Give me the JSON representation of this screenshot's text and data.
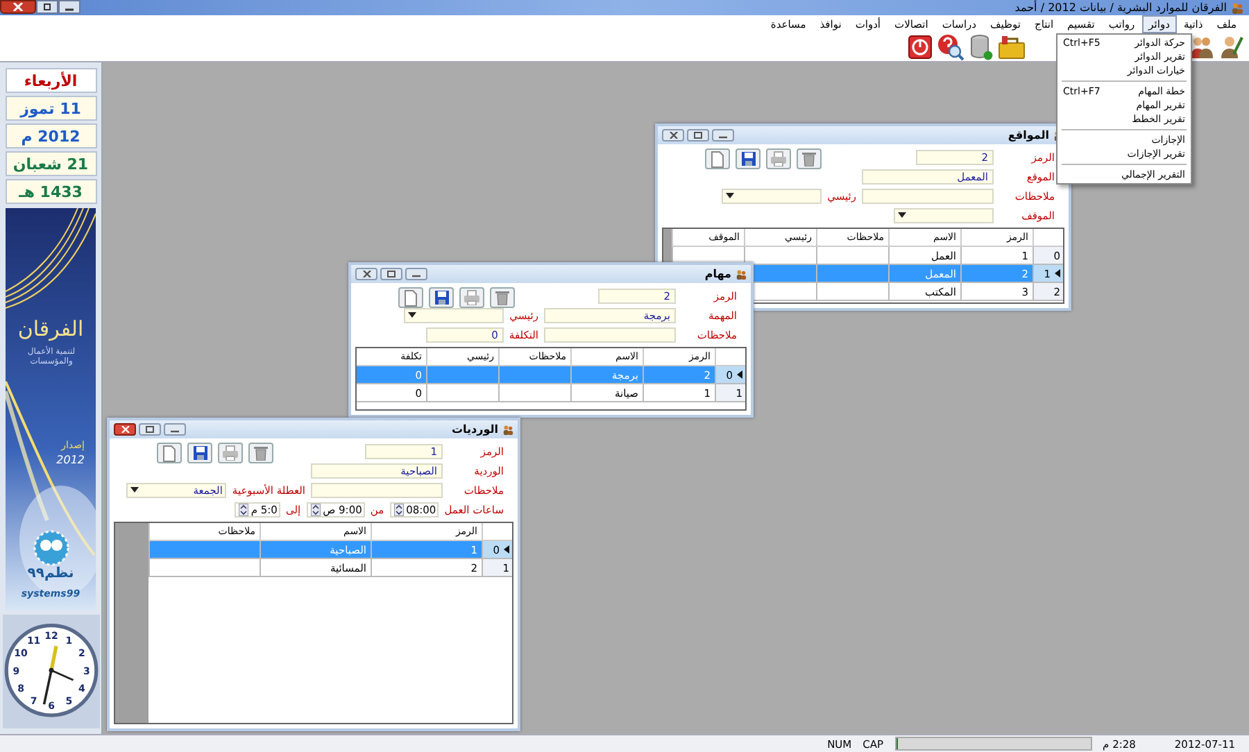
{
  "title_bar": {
    "title": "الفرقان للموارد البشرية / بيانات 2012 / أحمد"
  },
  "menu": [
    {
      "label": "ملف",
      "selected": false
    },
    {
      "label": "ذاتية",
      "selected": false
    },
    {
      "label": "دوائر",
      "selected": true
    },
    {
      "label": "رواتب",
      "selected": false
    },
    {
      "label": "تقسيم",
      "selected": false
    },
    {
      "label": "انتاج",
      "selected": false
    },
    {
      "label": "توظيف",
      "selected": false
    },
    {
      "label": "دراسات",
      "selected": false
    },
    {
      "label": "اتصالات",
      "selected": false
    },
    {
      "label": "أدوات",
      "selected": false
    },
    {
      "label": "نوافذ",
      "selected": false
    },
    {
      "label": "مساعدة",
      "selected": false
    }
  ],
  "dropdown": [
    {
      "kind": "item",
      "label": "حركة الدوائر",
      "shortcut": "Ctrl+F5"
    },
    {
      "kind": "item",
      "label": "تقرير الدوائر"
    },
    {
      "kind": "item",
      "label": "خيارات الدوائر"
    },
    {
      "kind": "separator"
    },
    {
      "kind": "item",
      "label": "خطة المهام",
      "shortcut": "Ctrl+F7"
    },
    {
      "kind": "item",
      "label": "تقرير المهام"
    },
    {
      "kind": "item",
      "label": "تقرير الخطط"
    },
    {
      "kind": "separator"
    },
    {
      "kind": "item",
      "label": "الإجازات"
    },
    {
      "kind": "item",
      "label": "تقرير الإجازات"
    },
    {
      "kind": "separator"
    },
    {
      "kind": "item",
      "label": "التقرير الإجمالي"
    }
  ],
  "calendar": [
    {
      "kind": "weekday",
      "text": "الأربعاء"
    },
    {
      "kind": "gregorian",
      "text": "11 تموز"
    },
    {
      "kind": "gregorian",
      "text": "2012 م"
    },
    {
      "kind": "hijri",
      "text": "21 شعبان"
    },
    {
      "kind": "hijri",
      "text": "1433 هـ"
    }
  ],
  "banner": {
    "title": "الفرقان",
    "subtitle": "لتنمية الأعمال والمؤسسات",
    "edition": "إصدار",
    "year": "2012",
    "brand": "نظم٩٩",
    "brand_latin": "systems99"
  },
  "clock": {
    "numerals": [
      "12",
      "1",
      "11",
      "2",
      "10",
      "3",
      "9",
      "4",
      "8",
      "5",
      "7",
      "6"
    ]
  },
  "windows": [
    {
      "title": "المواقع",
      "active": false,
      "fields": [
        [
          {
            "kind": "label",
            "text": "الرمز"
          },
          {
            "kind": "code",
            "value": "2"
          }
        ],
        [
          {
            "kind": "label",
            "text": "الموقع"
          },
          {
            "kind": "text",
            "value": "المعمل"
          }
        ],
        [
          {
            "kind": "label",
            "text": "ملاحظات"
          },
          {
            "kind": "text"
          },
          {
            "kind": "label",
            "text": "رئيسي"
          },
          {
            "kind": "combo"
          }
        ],
        [
          {
            "kind": "label",
            "text": "الموقف"
          },
          {
            "kind": "combo"
          }
        ]
      ],
      "table": {
        "columns": [
          "الرمز",
          "الاسم",
          "ملاحظات",
          "رئيسي",
          "الموقف"
        ],
        "rows": [
          {
            "index": "0",
            "selected": false,
            "current": false,
            "cells": [
              "1",
              "العمل",
              null,
              null,
              null
            ]
          },
          {
            "index": "1",
            "selected": true,
            "current": true,
            "cells": [
              "2",
              "المعمل",
              null,
              null,
              null
            ]
          },
          {
            "index": "2",
            "selected": false,
            "current": false,
            "cells": [
              "3",
              "المكتب",
              null,
              null,
              null
            ]
          }
        ]
      }
    },
    {
      "title": "مهام",
      "active": false,
      "fields": [
        [
          {
            "kind": "label",
            "text": "الرمز"
          },
          {
            "kind": "code",
            "value": "2"
          }
        ],
        [
          {
            "kind": "label",
            "text": "المهمة"
          },
          {
            "kind": "text",
            "value": "برمجة"
          },
          {
            "kind": "label",
            "text": "رئيسي"
          },
          {
            "kind": "combo"
          }
        ],
        [
          {
            "kind": "label",
            "text": "ملاحظات"
          },
          {
            "kind": "text"
          },
          {
            "kind": "label",
            "text": "التكلفة"
          },
          {
            "kind": "code",
            "value": "0"
          }
        ]
      ],
      "table": {
        "columns": [
          "الرمز",
          "الاسم",
          "ملاحظات",
          "رئيسي",
          "تكلفة"
        ],
        "rows": [
          {
            "index": "0",
            "selected": true,
            "current": true,
            "cells": [
              "2",
              "برمجة",
              null,
              null,
              "0"
            ]
          },
          {
            "index": "1",
            "selected": false,
            "current": false,
            "cells": [
              "1",
              "صيانة",
              null,
              null,
              "0"
            ]
          }
        ]
      }
    },
    {
      "title": "الورديات",
      "active": true,
      "fields": [
        [
          {
            "kind": "label",
            "text": "الرمز"
          },
          {
            "kind": "code",
            "value": "1"
          }
        ],
        [
          {
            "kind": "label",
            "text": "الوردية"
          },
          {
            "kind": "text",
            "value": "الصباحية"
          }
        ],
        [
          {
            "kind": "label",
            "text": "ملاحظات"
          },
          {
            "kind": "text"
          },
          {
            "kind": "label",
            "text": "العطلة الأسبوعية"
          },
          {
            "kind": "combo",
            "value": "الجمعة"
          }
        ],
        [
          {
            "kind": "label",
            "text": "ساعات العمل"
          },
          {
            "kind": "spin",
            "value": "08:00"
          },
          {
            "kind": "label",
            "text": "من"
          },
          {
            "kind": "spin",
            "value": "9:00 ص"
          },
          {
            "kind": "label",
            "text": "إلى"
          },
          {
            "kind": "spin",
            "value": "5:0 م"
          }
        ]
      ],
      "table": {
        "columns": [
          "الرمز",
          "الاسم",
          "ملاحظات"
        ],
        "rows": [
          {
            "index": "0",
            "selected": true,
            "current": true,
            "cells": [
              "1",
              "الصباحية",
              null
            ]
          },
          {
            "index": "1",
            "selected": false,
            "current": false,
            "cells": [
              "2",
              "المسائية",
              null
            ]
          }
        ]
      }
    }
  ],
  "status_bar": {
    "num": "NUM",
    "cap": "CAP",
    "progress": {
      "level": 0
    },
    "time": "2:28 م",
    "date": "2012-07-11"
  }
}
